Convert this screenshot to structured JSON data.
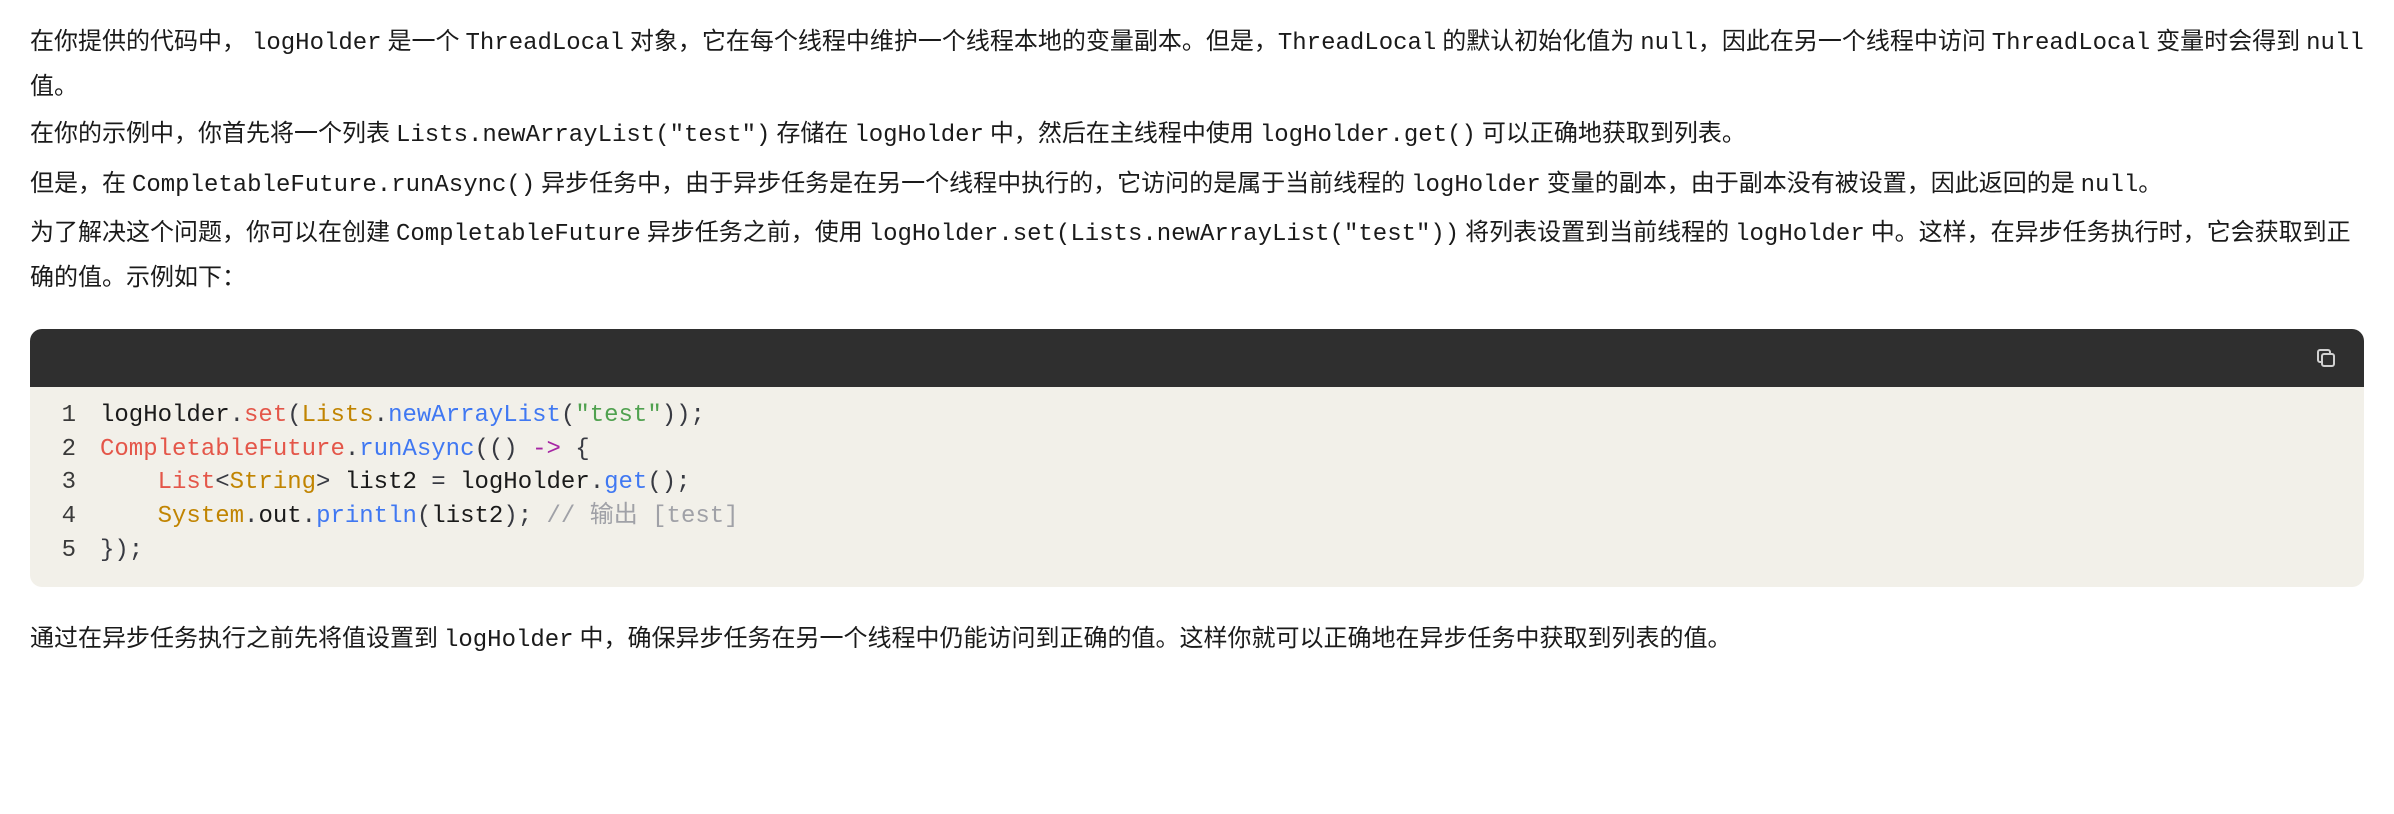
{
  "paragraphs": {
    "p1_a": "在你提供的代码中， ",
    "p1_code1": "logHolder",
    "p1_b": " 是一个 ",
    "p1_code2": "ThreadLocal",
    "p1_c": " 对象，它在每个线程中维护一个线程本地的变量副本。但是，",
    "p1_code3": "ThreadLocal",
    "p1_d": " 的默认初始化值为 ",
    "p1_code4": "null",
    "p1_e": "，因此在另一个线程中访问 ",
    "p1_code5": "ThreadLocal",
    "p1_f": " 变量时会得到 ",
    "p1_code6": "null",
    "p1_g": " 值。",
    "p2_a": "在你的示例中，你首先将一个列表 ",
    "p2_code1": "Lists.newArrayList(\"test\")",
    "p2_b": " 存储在 ",
    "p2_code2": "logHolder",
    "p2_c": " 中，然后在主线程中使用 ",
    "p2_code3": "logHolder.get()",
    "p2_d": " 可以正确地获取到列表。",
    "p3_a": "但是，在 ",
    "p3_code1": "CompletableFuture.runAsync()",
    "p3_b": " 异步任务中，由于异步任务是在另一个线程中执行的，它访问的是属于当前线程的 ",
    "p3_code2": "logHolder",
    "p3_c": " 变量的副本，由于副本没有被设置，因此返回的是 ",
    "p3_code3": "null",
    "p3_d": "。",
    "p4_a": "为了解决这个问题，你可以在创建 ",
    "p4_code1": "CompletableFuture",
    "p4_b": " 异步任务之前，使用 ",
    "p4_code2": "logHolder.set(Lists.newArrayList(\"test\"))",
    "p4_c": " 将列表设置到当前线程的 ",
    "p4_code3": "logHolder",
    "p4_d": " 中。这样，在异步任务执行时，它会获取到正确的值。示例如下：",
    "p5_a": "通过在异步任务执行之前先将值设置到 ",
    "p5_code1": "logHolder",
    "p5_b": " 中，确保异步任务在另一个线程中仍能访问到正确的值。这样你就可以正确地在异步任务中获取到列表的值。"
  },
  "code": {
    "line_numbers": [
      "1",
      "2",
      "3",
      "4",
      "5"
    ],
    "l1": {
      "t1": "logHolder",
      "t2": ".",
      "t3": "set",
      "t4": "(",
      "t5": "Lists",
      "t6": ".",
      "t7": "newArrayList",
      "t8": "(",
      "t9": "\"test\"",
      "t10": "));"
    },
    "l2": {
      "t1": "CompletableFuture",
      "t2": ".",
      "t3": "runAsync",
      "t4": "(() ",
      "t5": "->",
      "t6": " {"
    },
    "l3": {
      "indent": "    ",
      "t1": "List",
      "t2": "<",
      "t3": "String",
      "t4": "> ",
      "t5": "list2",
      "t6": " = ",
      "t7": "logHolder",
      "t8": ".",
      "t9": "get",
      "t10": "();"
    },
    "l4": {
      "indent": "    ",
      "t1": "System",
      "t2": ".",
      "t3": "out",
      "t4": ".",
      "t5": "println",
      "t6": "(",
      "t7": "list2",
      "t8": "); ",
      "t9": "// 输出 [test]"
    },
    "l5": {
      "t1": "});"
    }
  }
}
